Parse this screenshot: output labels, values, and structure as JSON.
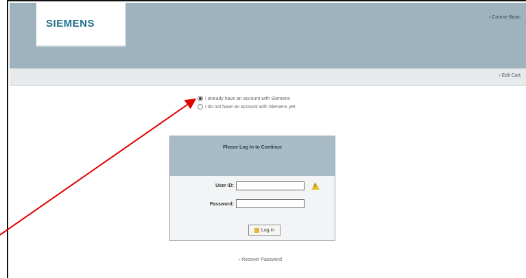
{
  "header": {
    "logo_text": "SIEMENS",
    "top_link": "› Course Basic"
  },
  "subbar": {
    "edit_link": "› Edit Cart"
  },
  "account_options": [
    {
      "label": "I already have an account with Siemens",
      "selected": true
    },
    {
      "label": "I do not have an account with Siemens yet",
      "selected": false
    }
  ],
  "login": {
    "title": "Please Log In to Continue",
    "user_id_label": "User ID:",
    "password_label": "Password:",
    "user_id_value": "",
    "password_value": "",
    "button_label": "Log in",
    "warning_icon": "warning-icon"
  },
  "recover_link": "› Recover Password",
  "colors": {
    "header_bg": "#9fb3be",
    "logo_text": "#1f6e8c",
    "arrow": "#e00000",
    "warning": "#e6c22a"
  }
}
